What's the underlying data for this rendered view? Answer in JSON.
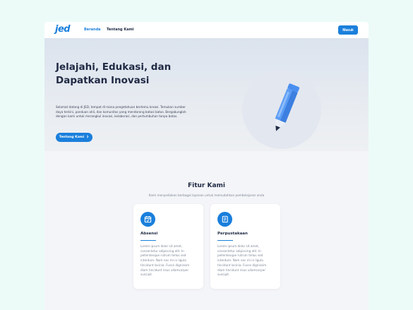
{
  "nav": {
    "logo": "Jed",
    "links": [
      {
        "label": "Beranda",
        "active": true
      },
      {
        "label": "Tentang Kami",
        "active": false
      }
    ],
    "login_label": "Masuk"
  },
  "hero": {
    "title": "Jelajahi, Edukasi, dan Dapatkan Inovasi",
    "description": "Selamat datang di JED, tempat di mana pengetahuan bertemu kreasi. Temukan sumber daya terkini, panduan ahli, dan komunitas yang mendorong batasi batas. Bergabunglah dengan kami untuk merangkul inovasi, kolaborasi, dan pertumbuhan tanpa batas.",
    "button_label": "Tentang Kami",
    "button_icon": "chevron-right-icon",
    "illustration": "pencil-icon"
  },
  "features": {
    "title": "Fitur Kami",
    "subtitle": "Kami menyediakan berbagai layanan untuk memudahkan pembelajaran anda",
    "cards": [
      {
        "icon": "calendar-check-icon",
        "title": "Absensi",
        "text": "Lorem ipsum dolor sit amet, consectetur adipiscing elit. In pellentesque rutrum tellus sed interdum. Nam nec mi in ligula tincidunt lacinia. Fusce dignissim diam tincidunt risus ullamcorper suscipit."
      },
      {
        "icon": "book-icon",
        "title": "Perpustakaan",
        "text": "Lorem ipsum dolor sit amet, consectetur adipiscing elit. In pellentesque rutrum tellus sed interdum. Nam nec mi in ligula tincidunt lacinia. Fusce dignissim diam tincidunt risus ullamcorper suscipit."
      }
    ]
  },
  "colors": {
    "primary": "#1a7fdc",
    "dark_text": "#1f2a44",
    "muted_text": "#7c8597",
    "page_bg": "#ecfbf8"
  }
}
